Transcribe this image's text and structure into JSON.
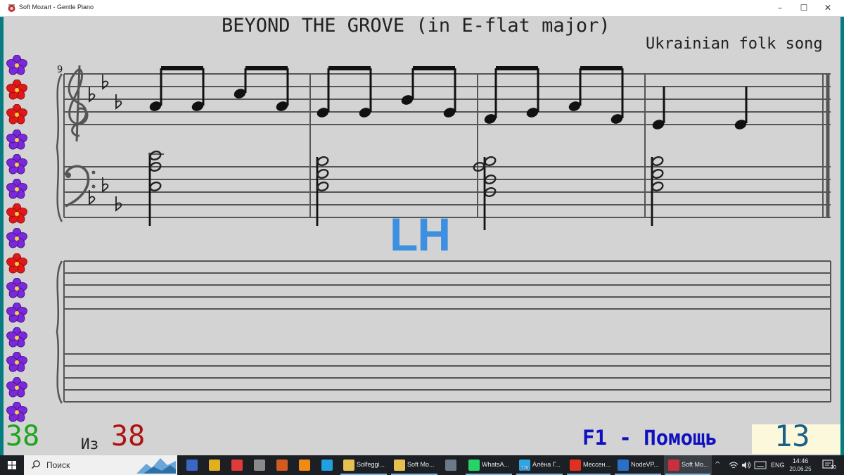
{
  "window": {
    "title": "Soft Mozart - Gentle Piano",
    "minimize_glyph": "–",
    "maximize_glyph": "☐",
    "close_glyph": "✕",
    "frame_color": "#067c80"
  },
  "song": {
    "title": "BEYOND THE GROVE (in E-flat major)",
    "subtitle": "Ukrainian folk song"
  },
  "score": {
    "measure_number": "9",
    "key_signature": "E-flat major",
    "hand_label": "LH",
    "hand_label_color": "#3d8fe0"
  },
  "flowers": [
    "purple",
    "red",
    "red",
    "purple",
    "purple",
    "purple",
    "red",
    "purple",
    "red",
    "purple",
    "purple",
    "purple",
    "purple",
    "purple",
    "purple"
  ],
  "status": {
    "current": "38",
    "of_label": "Из",
    "total": "38",
    "help": "F1 - Помощь",
    "score": "13",
    "current_color": "#1ea51e",
    "total_color": "#b01010",
    "help_color": "#1010c0"
  },
  "taskbar": {
    "search_placeholder": "Поиск",
    "apps": [
      {
        "label": "",
        "icon": "save-icon",
        "color": "#3a66c4"
      },
      {
        "label": "",
        "icon": "chrome-icon",
        "color": "#e0b020"
      },
      {
        "label": "",
        "icon": "screen-recorder-icon",
        "color": "#e03a3a"
      },
      {
        "label": "",
        "icon": "tools-icon",
        "color": "#8a8a8a"
      },
      {
        "label": "",
        "icon": "windows-store-icon",
        "color": "#d05a20"
      },
      {
        "label": "",
        "icon": "vlc-icon",
        "color": "#f08a10"
      },
      {
        "label": "",
        "icon": "skype-icon",
        "color": "#1fa0e0"
      },
      {
        "label": "Solfeggi...",
        "icon": "folder-icon",
        "color": "#e8c050"
      },
      {
        "label": "Soft Mo...",
        "icon": "folder-icon",
        "color": "#e8c050"
      },
      {
        "label": "",
        "icon": "calculator-icon",
        "color": "#6a7a8a"
      },
      {
        "label": "WhatsA...",
        "icon": "whatsapp-icon",
        "color": "#25d366"
      },
      {
        "label": "Алёна Г...",
        "icon": "telegram-icon",
        "color": "#2ea6e0"
      },
      {
        "label": "Мессен...",
        "icon": "yandex-icon",
        "color": "#e03020"
      },
      {
        "label": "NodeVP...",
        "icon": "nodevpn-icon",
        "color": "#2a70c8"
      },
      {
        "label": "Soft Mo...",
        "icon": "soft-mozart-icon",
        "color": "#c83040"
      }
    ],
    "telegram_badge": "229",
    "language": "ENG",
    "time": "14:46",
    "date": "20.06.25",
    "notifications": "30"
  }
}
